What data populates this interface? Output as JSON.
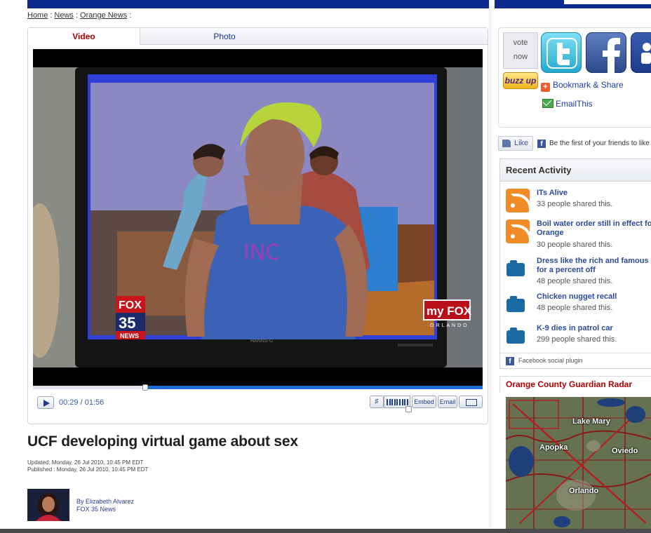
{
  "breadcrumb": {
    "home": "Home",
    "news": "News",
    "orange_news": "Orange News",
    "sep": ":"
  },
  "player": {
    "tabs": {
      "video": "Video",
      "photo": "Photo"
    },
    "current_time": "00:29",
    "duration": "01:56",
    "progress": 0.25,
    "embed_label": "Embed",
    "email_label": "Email",
    "overlay": {
      "fox": "FOX",
      "station": "35",
      "news": "NEWS",
      "myfox": "my FOX",
      "orlando": "ORLANDO",
      "shirt": "INC",
      "monitor": "HANNS-G"
    }
  },
  "article": {
    "headline": "UCF developing virtual game about sex",
    "updated": "Updated: Monday, 26 Jul 2010, 10:45 PM EDT",
    "published": "Published : Monday, 26 Jul 2010, 10:45 PM EDT",
    "author": "By Elizabeth Alvarez",
    "author_org": "FOX 35 News"
  },
  "share": {
    "vote_line1": "vote",
    "vote_line2": "now",
    "buzz": "buzz up",
    "bookmark": "Bookmark & Share",
    "email_this": "EmailThis"
  },
  "facebook": {
    "like": "Like",
    "friends_text": "Be the first of your friends to like this.",
    "f": "f"
  },
  "activity": {
    "title": "Recent Activity",
    "items": [
      {
        "icon": "rss-icon",
        "title": "ITs Alive",
        "count": "33 people shared this."
      },
      {
        "icon": "rss-icon",
        "title": "Boil water order still in effect for Orange",
        "count": "30 people shared this."
      },
      {
        "icon": "camera-icon",
        "title": "Dress like the rich and famous for a percent off",
        "count": "48 people shared this."
      },
      {
        "icon": "camera-icon",
        "title": "Chicken nugget recall",
        "count": "48 people shared this."
      },
      {
        "icon": "camera-icon",
        "title": "K-9 dies in patrol car",
        "count": "299 people shared this."
      }
    ],
    "footer": "Facebook social plugin"
  },
  "radar": {
    "title": "Orange County Guardian Radar",
    "labels": {
      "lake_mary": "Lake Mary",
      "apopka": "Apopka",
      "oviedo": "Oviedo",
      "orlando": "Orlando"
    }
  },
  "colors": {
    "fox_red": "#b40000",
    "link_blue": "#2a4a9a",
    "progress_blue": "#1e6bd8"
  }
}
